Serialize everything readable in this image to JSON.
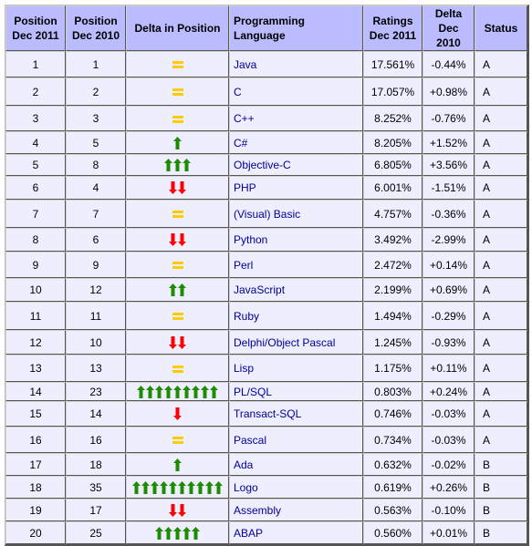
{
  "headers": {
    "pos2011": [
      "Position",
      "Dec 2011"
    ],
    "pos2010": [
      "Position",
      "Dec 2010"
    ],
    "delta_pos": "Delta in Position",
    "language": "Programming Language",
    "ratings": [
      "Ratings",
      "Dec 2011"
    ],
    "delta": [
      "Delta",
      "Dec 2010"
    ],
    "status": "Status"
  },
  "colors": {
    "header_bg": "#bbbbff",
    "cell_bg": "#eeeeff",
    "link": "#000099",
    "up_arrow": "#1e8c00",
    "down_arrow": "#ff0000",
    "equal": "#ffcc00"
  },
  "rows": [
    {
      "pos2011": "1",
      "pos2010": "1",
      "trend": "equal",
      "arrows": 1,
      "language": "Java",
      "ratings": "17.561%",
      "delta": "-0.44%",
      "status": "A"
    },
    {
      "pos2011": "2",
      "pos2010": "2",
      "trend": "equal",
      "arrows": 1,
      "language": "C",
      "ratings": "17.057%",
      "delta": "+0.98%",
      "status": "A"
    },
    {
      "pos2011": "3",
      "pos2010": "3",
      "trend": "equal",
      "arrows": 1,
      "language": "C++",
      "ratings": "8.252%",
      "delta": "-0.76%",
      "status": "A"
    },
    {
      "pos2011": "4",
      "pos2010": "5",
      "trend": "up",
      "arrows": 1,
      "language": "C#",
      "ratings": "8.205%",
      "delta": "+1.52%",
      "status": "A"
    },
    {
      "pos2011": "5",
      "pos2010": "8",
      "trend": "up",
      "arrows": 3,
      "language": "Objective-C",
      "ratings": "6.805%",
      "delta": "+3.56%",
      "status": "A"
    },
    {
      "pos2011": "6",
      "pos2010": "4",
      "trend": "down",
      "arrows": 2,
      "language": "PHP",
      "ratings": "6.001%",
      "delta": "-1.51%",
      "status": "A"
    },
    {
      "pos2011": "7",
      "pos2010": "7",
      "trend": "equal",
      "arrows": 1,
      "language": "(Visual) Basic",
      "ratings": "4.757%",
      "delta": "-0.36%",
      "status": "A"
    },
    {
      "pos2011": "8",
      "pos2010": "6",
      "trend": "down",
      "arrows": 2,
      "language": "Python",
      "ratings": "3.492%",
      "delta": "-2.99%",
      "status": "A"
    },
    {
      "pos2011": "9",
      "pos2010": "9",
      "trend": "equal",
      "arrows": 1,
      "language": "Perl",
      "ratings": "2.472%",
      "delta": "+0.14%",
      "status": "A"
    },
    {
      "pos2011": "10",
      "pos2010": "12",
      "trend": "up",
      "arrows": 2,
      "language": "JavaScript",
      "ratings": "2.199%",
      "delta": "+0.69%",
      "status": "A"
    },
    {
      "pos2011": "11",
      "pos2010": "11",
      "trend": "equal",
      "arrows": 1,
      "language": "Ruby",
      "ratings": "1.494%",
      "delta": "-0.29%",
      "status": "A"
    },
    {
      "pos2011": "12",
      "pos2010": "10",
      "trend": "down",
      "arrows": 2,
      "language": "Delphi/Object Pascal",
      "ratings": "1.245%",
      "delta": "-0.93%",
      "status": "A"
    },
    {
      "pos2011": "13",
      "pos2010": "13",
      "trend": "equal",
      "arrows": 1,
      "language": "Lisp",
      "ratings": "1.175%",
      "delta": "+0.11%",
      "status": "A"
    },
    {
      "pos2011": "14",
      "pos2010": "23",
      "trend": "up",
      "arrows": 9,
      "language": "PL/SQL",
      "ratings": "0.803%",
      "delta": "+0.24%",
      "status": "A"
    },
    {
      "pos2011": "15",
      "pos2010": "14",
      "trend": "down",
      "arrows": 1,
      "language": "Transact-SQL",
      "ratings": "0.746%",
      "delta": "-0.03%",
      "status": "A"
    },
    {
      "pos2011": "16",
      "pos2010": "16",
      "trend": "equal",
      "arrows": 1,
      "language": "Pascal",
      "ratings": "0.734%",
      "delta": "-0.03%",
      "status": "A"
    },
    {
      "pos2011": "17",
      "pos2010": "18",
      "trend": "up",
      "arrows": 1,
      "language": "Ada",
      "ratings": "0.632%",
      "delta": "-0.02%",
      "status": "B"
    },
    {
      "pos2011": "18",
      "pos2010": "35",
      "trend": "up",
      "arrows": 10,
      "language": "Logo",
      "ratings": "0.619%",
      "delta": "+0.26%",
      "status": "B"
    },
    {
      "pos2011": "19",
      "pos2010": "17",
      "trend": "down",
      "arrows": 2,
      "language": "Assembly",
      "ratings": "0.563%",
      "delta": "-0.10%",
      "status": "B"
    },
    {
      "pos2011": "20",
      "pos2010": "25",
      "trend": "up",
      "arrows": 5,
      "language": "ABAP",
      "ratings": "0.560%",
      "delta": "+0.01%",
      "status": "B"
    }
  ]
}
